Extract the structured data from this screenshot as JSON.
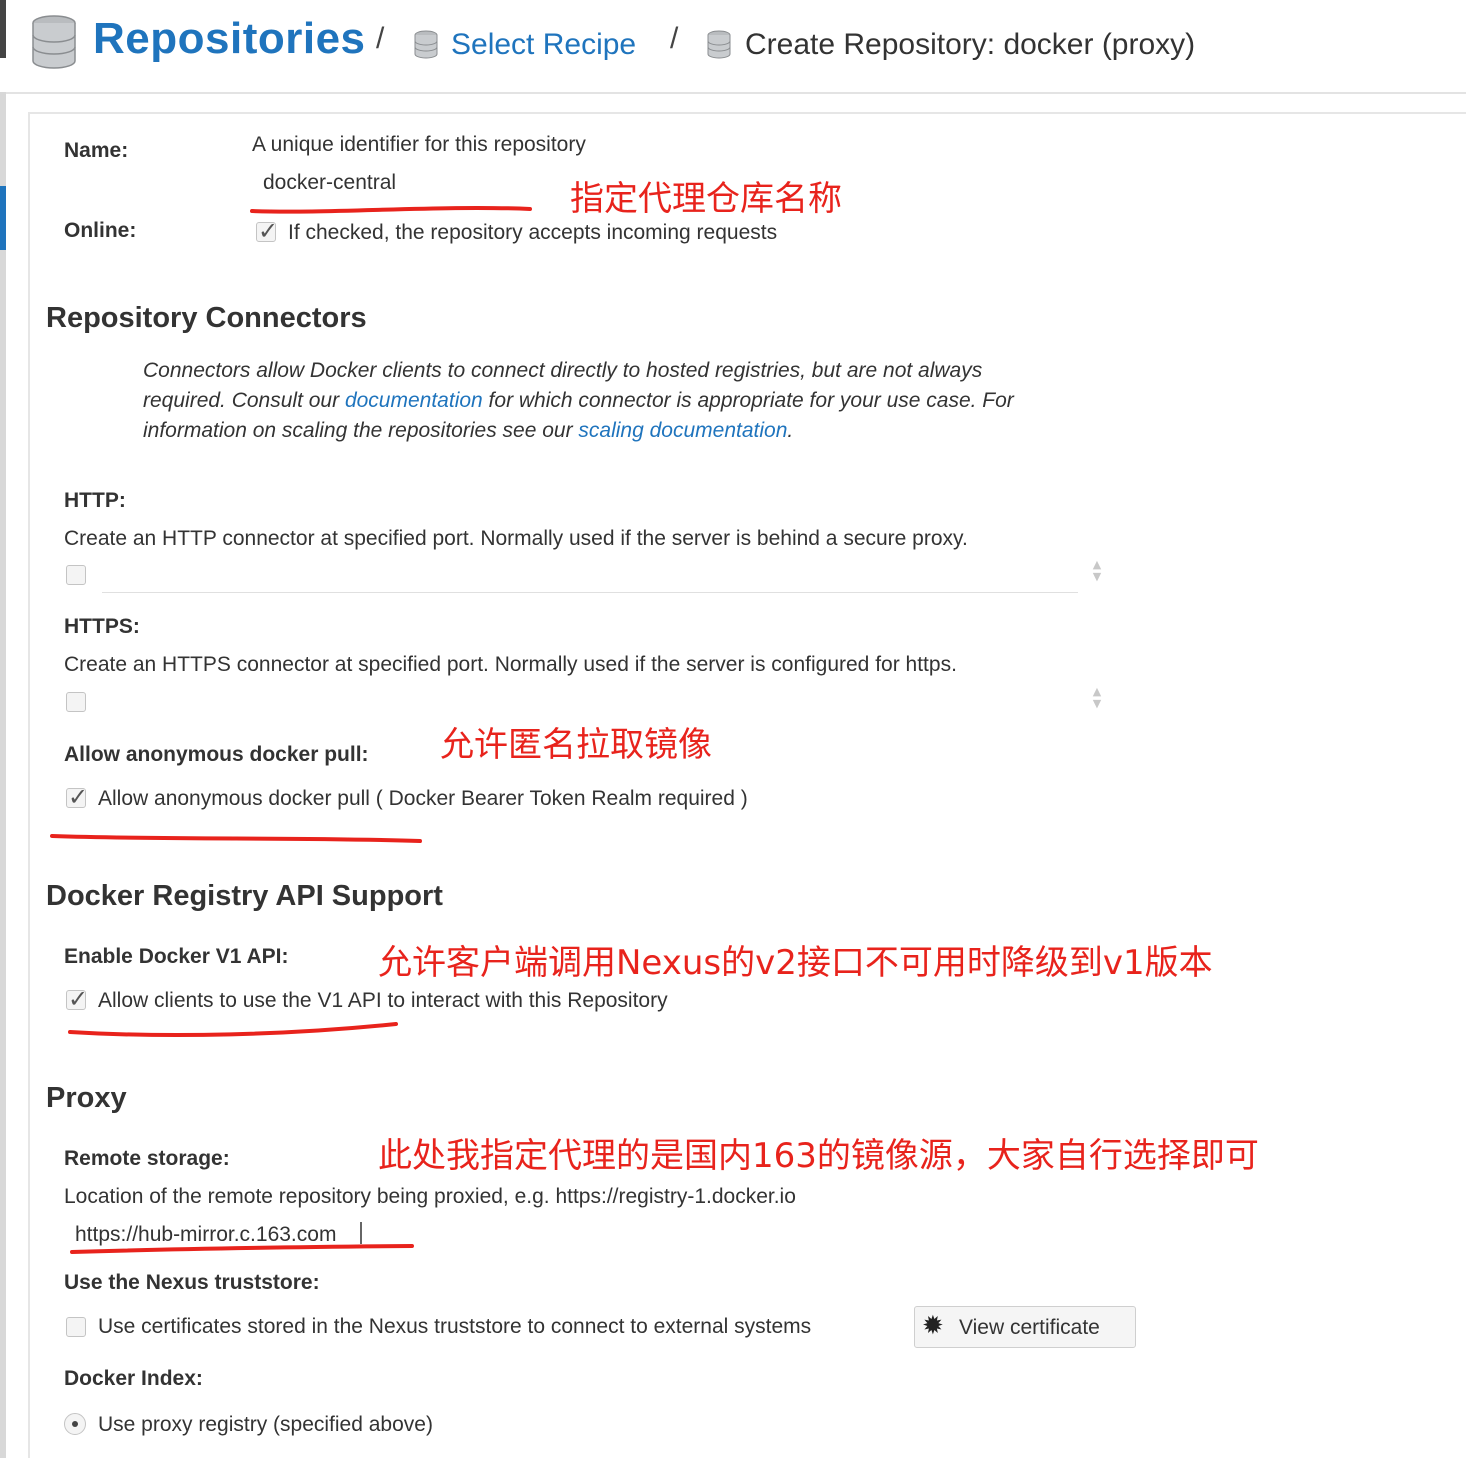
{
  "header": {
    "title": "Repositories",
    "sep1": "/",
    "link": "Select Recipe",
    "sep2": "/",
    "current": "Create Repository: docker (proxy)"
  },
  "name": {
    "label": "Name:",
    "help": "A unique identifier for this repository",
    "value": "docker-central"
  },
  "online": {
    "label": "Online:",
    "checked": true,
    "text": "If checked, the repository accepts incoming requests"
  },
  "connectors": {
    "heading": "Repository Connectors",
    "desc_1": "Connectors allow Docker clients to connect directly to hosted registries, but are not always required. Consult our ",
    "link_1": "documentation",
    "desc_2": " for which connector is appropriate for your use case. For information on scaling the repositories see our ",
    "link_2": "scaling documentation",
    "desc_3": ".",
    "http_label": "HTTP:",
    "http_help": "Create an HTTP connector at specified port. Normally used if the server is behind a secure proxy.",
    "https_label": "HTTPS:",
    "https_help": "Create an HTTPS connector at specified port. Normally used if the server is configured for https.",
    "anon_label": "Allow anonymous docker pull:",
    "anon_text": "Allow anonymous docker pull ( Docker Bearer Token Realm required )"
  },
  "api": {
    "heading": "Docker Registry API Support",
    "v1_label": "Enable Docker V1 API:",
    "v1_text": "Allow clients to use the V1 API to interact with this Repository"
  },
  "proxy": {
    "heading": "Proxy",
    "remote_label": "Remote storage:",
    "remote_help": "Location of the remote repository being proxied, e.g. https://registry-1.docker.io",
    "remote_value": "https://hub-mirror.c.163.com",
    "truststore_label": "Use the Nexus truststore:",
    "truststore_text": "Use certificates stored in the Nexus truststore to connect to external systems",
    "view_cert": "View certificate",
    "index_label": "Docker Index:",
    "index_option": "Use proxy registry (specified above)"
  },
  "annotations": {
    "a1": "指定代理仓库名称",
    "a2": "允许匿名拉取镜像",
    "a3": "允许客户端调用Nexus的v2接口不可用时降级到v1版本",
    "a4": "此处我指定代理的是国内163的镜像源，大家自行选择即可"
  },
  "colors": {
    "accent": "#1f74bd",
    "annotation": "#e8231c"
  },
  "icons": {
    "db": "database-icon",
    "gear": "gear-icon",
    "check": "checkmark-icon"
  }
}
